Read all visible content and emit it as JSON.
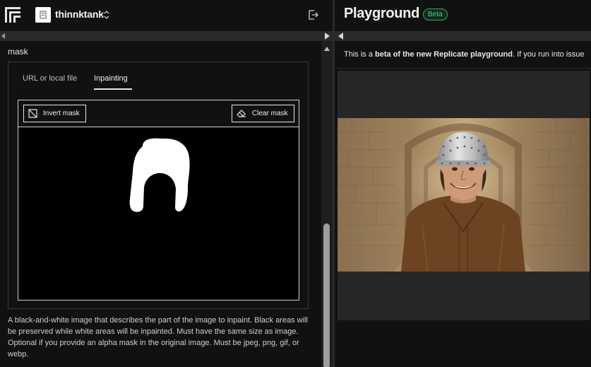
{
  "header": {
    "org_name": "thinnktank"
  },
  "mask_field": {
    "label": "mask",
    "tabs": [
      {
        "label": "URL or local file"
      },
      {
        "label": "Inpainting",
        "active": true
      }
    ],
    "invert_label": "Invert mask",
    "clear_label": "Clear mask",
    "description": "A black-and-white image that describes the part of the image to inpaint. Black areas will be preserved while white areas will be inpainted. Must have the same size as image. Optional if you provide an alpha mask in the original image. Must be jpeg, png, gif, or webp."
  },
  "playground": {
    "title": "Playground",
    "badge": "Beta",
    "notice_prefix": "This is a ",
    "notice_bold": "beta of the new Replicate playground",
    "notice_suffix": ". If you run into issue"
  },
  "colors": {
    "background": "#111111",
    "badge_green": "#57d18d",
    "panel": "#262626"
  }
}
